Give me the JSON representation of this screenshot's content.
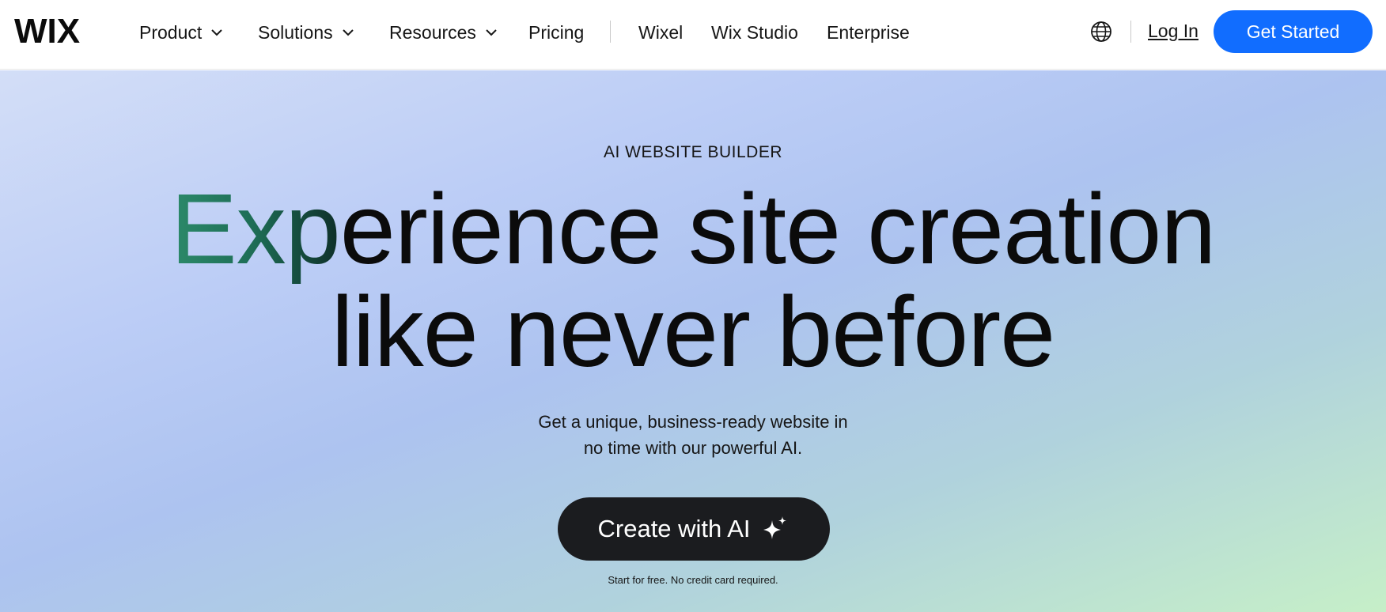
{
  "header": {
    "logo_text": "WIX",
    "nav": [
      {
        "label": "Product",
        "has_dropdown": true
      },
      {
        "label": "Solutions",
        "has_dropdown": true
      },
      {
        "label": "Resources",
        "has_dropdown": true
      },
      {
        "label": "Pricing",
        "has_dropdown": false
      },
      {
        "label": "Wixel",
        "has_dropdown": false
      },
      {
        "label": "Wix Studio",
        "has_dropdown": false
      },
      {
        "label": "Enterprise",
        "has_dropdown": false
      }
    ],
    "language_icon": "globe-icon",
    "login_label": "Log In",
    "get_started_label": "Get Started"
  },
  "hero": {
    "eyebrow": "AI WEBSITE BUILDER",
    "headline_accent": "Exp",
    "headline_line1_rest": "erience site creation",
    "headline_line2": "like never before",
    "subtext_line1": "Get a unique, business-ready website in",
    "subtext_line2": "no time with our powerful AI.",
    "cta_label": "Create with AI",
    "cta_icon": "sparkle-icon",
    "note": "Start for free. No credit card required."
  },
  "colors": {
    "brand_blue": "#116dff",
    "cta_dark": "#1b1c1f",
    "accent_green": "#2c8a6a"
  }
}
